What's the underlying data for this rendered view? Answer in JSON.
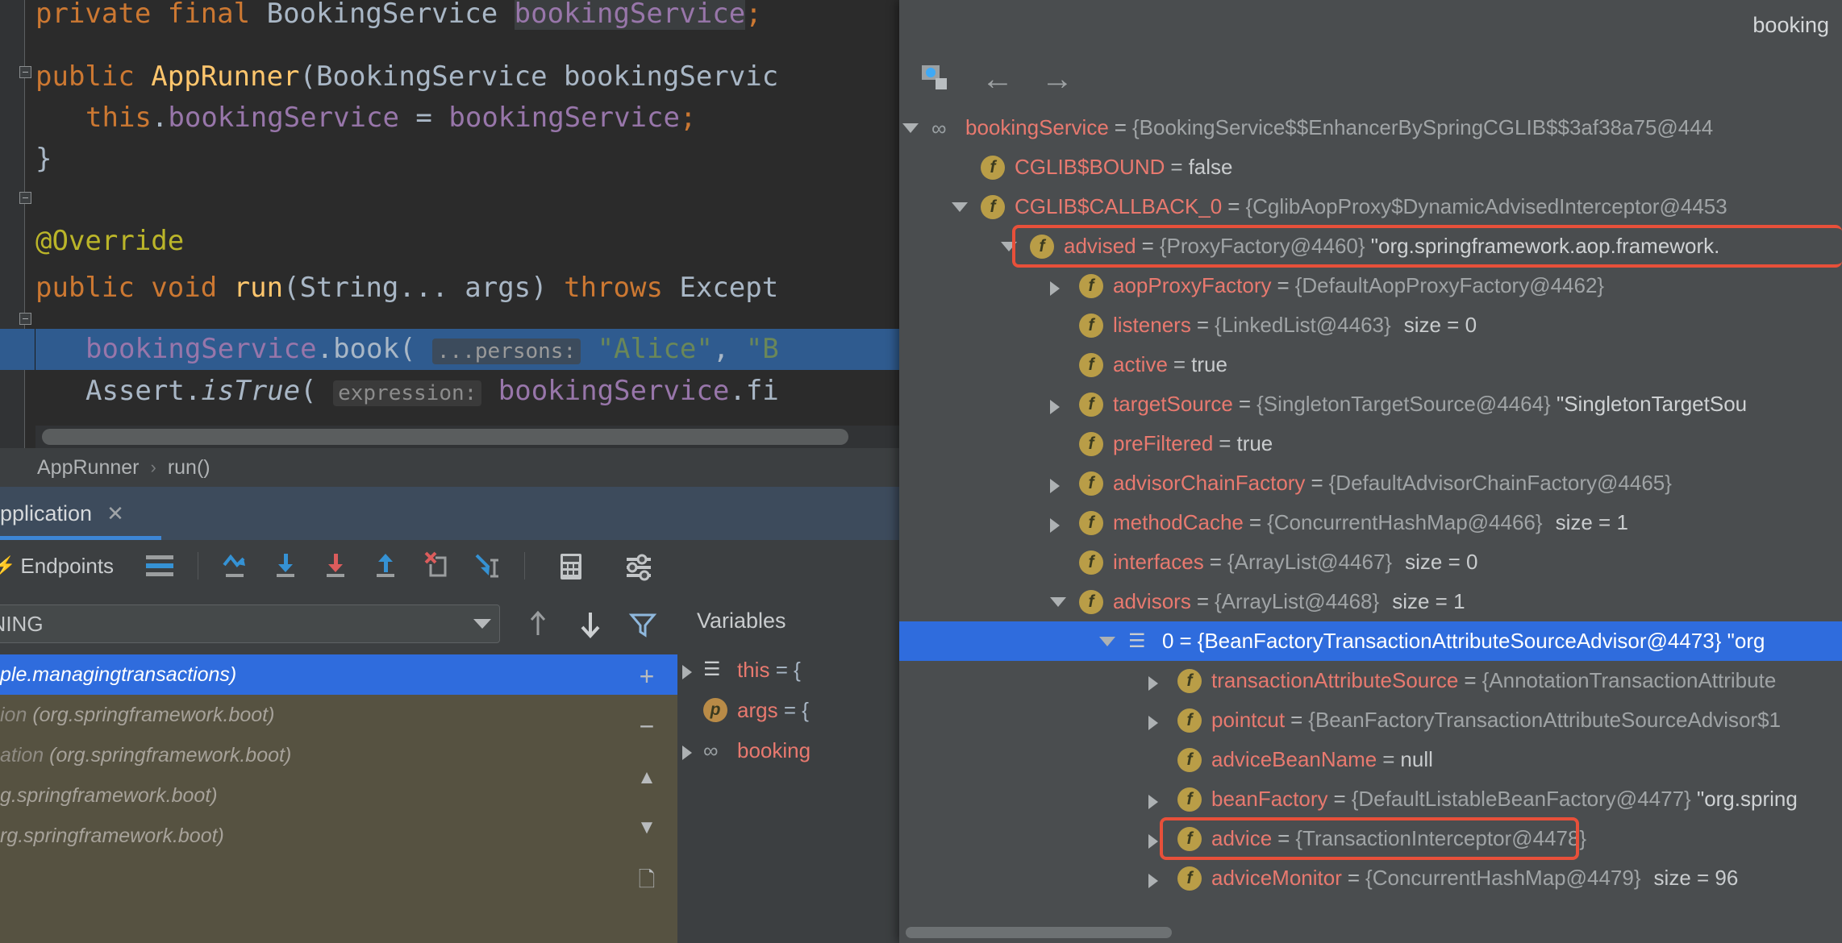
{
  "editor": {
    "lines": [
      {
        "indent": 0,
        "tokens": [
          {
            "t": "private ",
            "c": "kw"
          },
          {
            "t": "final ",
            "c": "kw"
          },
          {
            "t": "BookingService ",
            "c": "cls"
          },
          {
            "t": "bookingService",
            "c": "fld-hl"
          },
          {
            "t": ";",
            "c": "kw"
          }
        ]
      },
      {
        "indent": 0,
        "tokens": []
      },
      {
        "indent": 0,
        "tokens": [
          {
            "t": "public ",
            "c": "kw"
          },
          {
            "t": "AppRunner",
            "c": "mth"
          },
          {
            "t": "(",
            "c": "punct"
          },
          {
            "t": "BookingService bookingServic",
            "c": "cls"
          }
        ]
      },
      {
        "indent": 1,
        "tokens": [
          {
            "t": "this",
            "c": "kw"
          },
          {
            "t": ".",
            "c": "punct"
          },
          {
            "t": "bookingService",
            "c": "fld"
          },
          {
            "t": " = ",
            "c": "punct"
          },
          {
            "t": "bookingService",
            "c": "fld"
          },
          {
            "t": ";",
            "c": "kw"
          }
        ]
      },
      {
        "indent": 0,
        "tokens": [
          {
            "t": "}",
            "c": "cls"
          }
        ]
      },
      {
        "indent": 0,
        "tokens": []
      },
      {
        "indent": 0,
        "tokens": [
          {
            "t": "@Override",
            "c": "ann"
          }
        ]
      },
      {
        "indent": 0,
        "tokens": [
          {
            "t": "public ",
            "c": "kw"
          },
          {
            "t": "void ",
            "c": "kw"
          },
          {
            "t": "run",
            "c": "mth"
          },
          {
            "t": "(",
            "c": "punct"
          },
          {
            "t": "String",
            "c": "cls"
          },
          {
            "t": "... args) ",
            "c": "punct"
          },
          {
            "t": "throws ",
            "c": "kw"
          },
          {
            "t": "Except",
            "c": "cls"
          }
        ]
      },
      {
        "indent": 1,
        "tokens": [
          {
            "t": "bookingService",
            "c": "fld"
          },
          {
            "t": ".",
            "c": "punct"
          },
          {
            "t": "book",
            "c": "cls"
          },
          {
            "t": "( ",
            "c": "punct"
          },
          {
            "t": "...persons:",
            "c": "hint"
          },
          {
            "t": " \"Alice\"",
            "c": "str"
          },
          {
            "t": ", ",
            "c": "punct"
          },
          {
            "t": "\"B",
            "c": "str"
          }
        ]
      },
      {
        "indent": 1,
        "tokens": [
          {
            "t": "Assert",
            "c": "cls"
          },
          {
            "t": ".",
            "c": "punct"
          },
          {
            "t": "isTrue",
            "c": "mth-i"
          },
          {
            "t": "( ",
            "c": "punct"
          },
          {
            "t": "expression:",
            "c": "hint2"
          },
          {
            "t": " bookingService",
            "c": "fld"
          },
          {
            "t": ".",
            "c": "punct"
          },
          {
            "t": "fi",
            "c": "cls"
          }
        ]
      }
    ],
    "breadcrumb": {
      "class": "AppRunner",
      "separator": "›",
      "method": "run()"
    }
  },
  "toolwindow": {
    "tab_label": "pplication",
    "close_icon": "close-icon"
  },
  "debug_toolbar": {
    "endpoints_label": "Endpoints",
    "icons": [
      {
        "name": "frames-icon",
        "glyph": "list"
      },
      {
        "name": "step-over-icon",
        "glyph": "step-over"
      },
      {
        "name": "step-into-icon",
        "glyph": "step-into"
      },
      {
        "name": "force-step-into-icon",
        "glyph": "force-step-into"
      },
      {
        "name": "step-out-icon",
        "glyph": "step-out"
      },
      {
        "name": "drop-frame-icon",
        "glyph": "drop-frame"
      },
      {
        "name": "run-to-cursor-icon",
        "glyph": "run-to-cursor"
      },
      {
        "name": "evaluate-expression-icon",
        "glyph": "calculator"
      },
      {
        "name": "settings-icon",
        "glyph": "sliders"
      }
    ]
  },
  "frames": {
    "thread_selector_value": "UNNING",
    "items": [
      {
        "text": "ple.managingtransactions)",
        "package": "",
        "selected": true
      },
      {
        "text": "ion ",
        "package": "(org.springframework.boot)",
        "selected": false
      },
      {
        "text": "ation ",
        "package": "(org.springframework.boot)",
        "selected": false
      },
      {
        "text": "",
        "package": "g.springframework.boot)",
        "selected": false
      },
      {
        "text": "",
        "package": "rg.springframework.boot)",
        "selected": false
      }
    ],
    "nav_up_icon": "arrow-up-icon",
    "nav_down_icon": "arrow-down-icon",
    "filter_icon": "filter-icon"
  },
  "variables": {
    "title": "Variables",
    "add_icon": "plus-icon",
    "remove_icon": "minus-icon",
    "up_icon": "triangle-up-icon",
    "down_icon": "triangle-down-icon",
    "copy_icon": "copy-icon",
    "rows": [
      {
        "name": "this",
        "value": "= {",
        "icon": "list-icon",
        "expandable": true
      },
      {
        "name": "args",
        "value": "= {",
        "icon": "p-icon",
        "expandable": false
      },
      {
        "name": "booking",
        "value": "",
        "icon": "glasses-icon",
        "expandable": true
      }
    ]
  },
  "popup": {
    "title": "booking",
    "toolbar": {
      "inspect_icon": "inspect-icon",
      "back_icon": "arrow-left-icon",
      "forward_icon": "arrow-right-icon"
    },
    "tree": [
      {
        "depth": 0,
        "arrow": "open",
        "icon": "glasses",
        "name": "bookingService",
        "eq": "=",
        "value": "{BookingService$$EnhancerBySpringCGLIB$$3af38a75@444",
        "size": "",
        "highlight": false,
        "selected": false
      },
      {
        "depth": 1,
        "arrow": "none",
        "icon": "f",
        "name": "CGLIB$BOUND",
        "eq": "=",
        "value": "false",
        "valueBold": true,
        "size": "",
        "highlight": false,
        "selected": false
      },
      {
        "depth": 1,
        "arrow": "open",
        "icon": "f",
        "name": "CGLIB$CALLBACK_0",
        "eq": "=",
        "value": "{CglibAopProxy$DynamicAdvisedInterceptor@4453",
        "size": "",
        "highlight": false,
        "selected": false
      },
      {
        "depth": 2,
        "arrow": "open",
        "icon": "f",
        "name": "advised",
        "eq": "=",
        "value": "{ProxyFactory@4460}",
        "extra": "\"org.springframework.aop.framework.",
        "size": "",
        "highlight": true,
        "selected": false
      },
      {
        "depth": 3,
        "arrow": "closed",
        "icon": "f",
        "name": "aopProxyFactory",
        "eq": "=",
        "value": "{DefaultAopProxyFactory@4462}",
        "size": "",
        "highlight": false,
        "selected": false
      },
      {
        "depth": 3,
        "arrow": "none",
        "icon": "f",
        "name": "listeners",
        "eq": "=",
        "value": "{LinkedList@4463}",
        "size": "size = 0",
        "highlight": false,
        "selected": false
      },
      {
        "depth": 3,
        "arrow": "none",
        "icon": "f",
        "name": "active",
        "eq": "=",
        "value": "true",
        "valueBold": true,
        "size": "",
        "highlight": false,
        "selected": false
      },
      {
        "depth": 3,
        "arrow": "closed",
        "icon": "f",
        "name": "targetSource",
        "eq": "=",
        "value": "{SingletonTargetSource@4464}",
        "extra": "\"SingletonTargetSou",
        "size": "",
        "highlight": false,
        "selected": false
      },
      {
        "depth": 3,
        "arrow": "none",
        "icon": "f",
        "name": "preFiltered",
        "eq": "=",
        "value": "true",
        "valueBold": true,
        "size": "",
        "highlight": false,
        "selected": false
      },
      {
        "depth": 3,
        "arrow": "closed",
        "icon": "f",
        "name": "advisorChainFactory",
        "eq": "=",
        "value": "{DefaultAdvisorChainFactory@4465}",
        "size": "",
        "highlight": false,
        "selected": false
      },
      {
        "depth": 3,
        "arrow": "closed",
        "icon": "f",
        "name": "methodCache",
        "eq": "=",
        "value": "{ConcurrentHashMap@4466}",
        "size": "size = 1",
        "highlight": false,
        "selected": false
      },
      {
        "depth": 3,
        "arrow": "none",
        "icon": "f",
        "name": "interfaces",
        "eq": "=",
        "value": "{ArrayList@4467}",
        "size": "size = 0",
        "highlight": false,
        "selected": false
      },
      {
        "depth": 3,
        "arrow": "open",
        "icon": "f",
        "name": "advisors",
        "eq": "=",
        "value": "{ArrayList@4468}",
        "size": "size = 1",
        "highlight": false,
        "selected": false
      },
      {
        "depth": 4,
        "arrow": "open",
        "icon": "list",
        "name": "0",
        "eq": "=",
        "value": "{BeanFactoryTransactionAttributeSourceAdvisor@4473}",
        "extra": "\"org",
        "size": "",
        "highlight": false,
        "selected": true
      },
      {
        "depth": 5,
        "arrow": "closed",
        "icon": "f",
        "name": "transactionAttributeSource",
        "eq": "=",
        "value": "{AnnotationTransactionAttribute",
        "size": "",
        "highlight": false,
        "selected": false
      },
      {
        "depth": 5,
        "arrow": "closed",
        "icon": "f",
        "name": "pointcut",
        "eq": "=",
        "value": "{BeanFactoryTransactionAttributeSourceAdvisor$1",
        "size": "",
        "highlight": false,
        "selected": false
      },
      {
        "depth": 5,
        "arrow": "none",
        "icon": "f",
        "name": "adviceBeanName",
        "eq": "=",
        "value": "null",
        "valueBold": true,
        "size": "",
        "highlight": false,
        "selected": false
      },
      {
        "depth": 5,
        "arrow": "closed",
        "icon": "f",
        "name": "beanFactory",
        "eq": "=",
        "value": "{DefaultListableBeanFactory@4477}",
        "extra": "\"org.spring",
        "size": "",
        "highlight": false,
        "selected": false
      },
      {
        "depth": 5,
        "arrow": "closed",
        "icon": "f",
        "name": "advice",
        "eq": "=",
        "value": "{TransactionInterceptor@4478}",
        "size": "",
        "highlight": true,
        "selected": false
      },
      {
        "depth": 5,
        "arrow": "closed",
        "icon": "f",
        "name": "adviceMonitor",
        "eq": "=",
        "value": "{ConcurrentHashMap@4479}",
        "size": "size = 96",
        "highlight": false,
        "selected": false
      }
    ]
  },
  "colors": {
    "accent_blue": "#2f6cdd",
    "highlight_red": "#e8503a",
    "field_name": "#e8796f",
    "editor_bg": "#2b2b2b",
    "panel_bg": "#3c3f41",
    "popup_bg": "#4a4d4f",
    "frames_bg": "#565241"
  }
}
